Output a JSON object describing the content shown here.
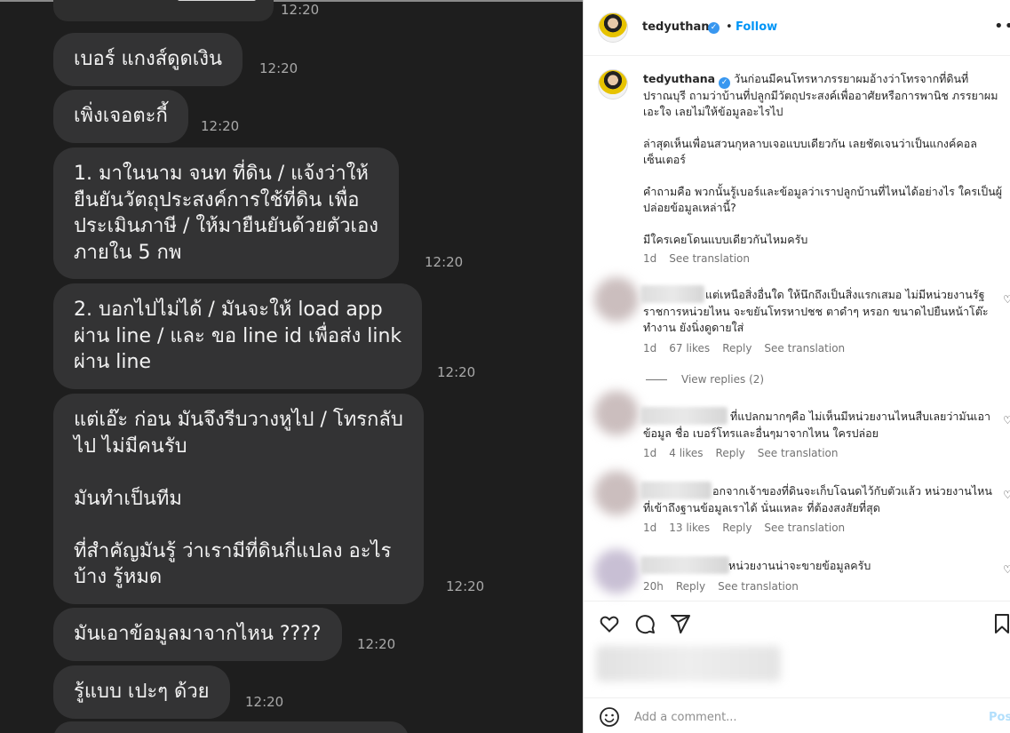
{
  "chat": {
    "messages": [
      {
        "text": "",
        "time": "12:20"
      },
      {
        "text": "เบอร์ แกงส์ดูดเงิน",
        "time": "12:20"
      },
      {
        "text": "เพิ่งเจอตะกี้",
        "time": "12:20"
      },
      {
        "text": "1. มาในนาม จนท ที่ดิน / แจ้งว่าให้\nยืนยันวัตถุประสงค์การใช้ที่ดิน เพื่อ\nประเมินภาษี / ให้มายืนยันด้วยตัวเอง\nภายใน 5 กพ",
        "time": "12:20"
      },
      {
        "text": "2. บอกไปไม่ได้ / มันจะให้ load app\nผ่าน line / และ ขอ line id เพื่อส่ง link\nผ่าน line",
        "time": "12:20"
      },
      {
        "text": "แต่เอ๊ะ ก่อน มันจึงรีบวางหูไป / โทรกลับ\nไป ไม่มีคนรับ\n\nมันทำเป็นทีม\n\nที่สำคัญมันรู้ ว่าเรามีที่ดินกี่แปลง อะไร\nบ้าง รู้หมด",
        "time": "12:20"
      },
      {
        "text": "มันเอาข้อมูลมาจากไหน ????",
        "time": "12:20"
      },
      {
        "text": "รู้แบบ เปะๆ ด้วย",
        "time": "12:20"
      }
    ]
  },
  "post": {
    "author": "tedyuthana",
    "follow_label": "Follow",
    "separator": "•",
    "caption_user": "tedyuthana",
    "caption_paragraphs": [
      "วันก่อนมีคนโทรหาภรรยาผมอ้างว่าโทรจากที่ดินที่ปราณบุรี ถามว่าบ้านที่ปลูกมีวัตถุประสงค์เพื่ออาศัยหรือการพานิช ภรรยาผมเอะใจ เลยไม่ให้ข้อมูลอะไรไป",
      "ล่าสุดเห็นเพื่อนสวนกุหลาบเจอแบบเดียวกัน เลยชัดเจนว่าเป็นแกงค์คอลเซ็นเตอร์",
      "คำถามคือ พวกนั้นรู้เบอร์และข้อมูลว่าเราปลูกบ้านที่ไหนได้อย่างไร ใครเป็นผู้ปล่อยข้อมูลเหล่านี้?",
      "มีใครเคยโดนแบบเดียวกันไหมครับ"
    ],
    "caption_age": "1d",
    "see_translation": "See translation",
    "comments": [
      {
        "text": "แต่เหนือสิ่งอื่นใด ให้นึกถึงเป็นสิ่งแรกเสมอ ไม่มีหน่วยงานรัฐ ราชการหน่วยไหน จะขยันโทรหาปชช ตาดำๆ หรอก ขนาดไปยืนหน้าโต๊ะทำงาน ยังนิ่งดูดายใส่",
        "age": "1d",
        "likes": "67 likes",
        "reply": "Reply",
        "see_translation": "See translation",
        "view_replies": "View replies (2)"
      },
      {
        "text": "ที่แปลกมากๆคือ ไม่เห็นมีหน่วยงานไหนสืบเลยว่ามันเอาข้อมูล ชื่อ เบอร์โทรและอื่นๆมาจากไหน ใครปล่อย",
        "age": "1d",
        "likes": "4 likes",
        "reply": "Reply",
        "see_translation": "See translation"
      },
      {
        "text": "อกจากเจ้าของที่ดินจะเก็บโฉนดไว้กับตัวแล้ว หน่วยงานไหนที่เข้าถึงฐานข้อมูลเราได้ นั่นแหละ ที่ต้องสงสัยที่สุด",
        "age": "1d",
        "likes": "13 likes",
        "reply": "Reply",
        "see_translation": "See translation"
      },
      {
        "text": "หน่วยงานน่าจะขายข้อมูลครับ",
        "age": "20h",
        "reply": "Reply",
        "see_translation": "See translation"
      }
    ],
    "add_comment_placeholder": "Add a comment...",
    "post_label": "Post"
  },
  "colors": {
    "chat_bg": "#1e1e1e",
    "bubble": "#333334",
    "accent": "#0095f6",
    "verified": "#3897f0"
  },
  "icons": [
    "verified-badge-icon",
    "more-options-icon",
    "heart-icon",
    "comment-icon",
    "share-icon",
    "bookmark-icon",
    "emoji-icon"
  ]
}
